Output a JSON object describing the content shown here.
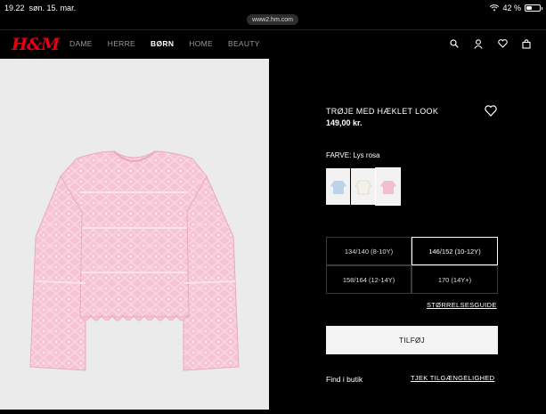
{
  "status_bar": {
    "time": "19.22",
    "date": "søn. 15. mar.",
    "battery": "42 %",
    "battery_level": 0.42
  },
  "browser": {
    "url": "www2.hm.com"
  },
  "header": {
    "logo": "H&M",
    "nav": [
      {
        "label": "DAME",
        "active": false
      },
      {
        "label": "HERRE",
        "active": false
      },
      {
        "label": "BØRN",
        "active": true
      },
      {
        "label": "HOME",
        "active": false
      },
      {
        "label": "BEAUTY",
        "active": false
      }
    ],
    "icons": [
      "search-icon",
      "account-icon",
      "favorites-icon",
      "bag-icon"
    ]
  },
  "product": {
    "title": "TRØJE MED HÆKLET LOOK",
    "price": "149,00 kr.",
    "color_label": "FARVE: Lys rosa",
    "swatches": [
      {
        "name": "light-blue",
        "color": "#bcd3ea",
        "selected": false
      },
      {
        "name": "white",
        "color": "#f3f1e8",
        "selected": false
      },
      {
        "name": "light-pink",
        "color": "#f2bfd0",
        "selected": true
      }
    ],
    "sizes": [
      {
        "label": "134/140 (8-10Y)",
        "selected": false
      },
      {
        "label": "146/152 (10-12Y)",
        "selected": true
      },
      {
        "label": "158/164 (12-14Y)",
        "selected": false
      },
      {
        "label": "170 (14Y+)",
        "selected": false
      }
    ],
    "size_guide": "STØRRELSESGUIDE",
    "add_button": "TILFØJ",
    "find_in_store": "Find i butik",
    "check_availability": "TJEK TILGÆNGELIGHED"
  },
  "colors": {
    "brand": "#e50010",
    "sweater": "#f6c4d4",
    "image_bg": "#ebebeb"
  }
}
